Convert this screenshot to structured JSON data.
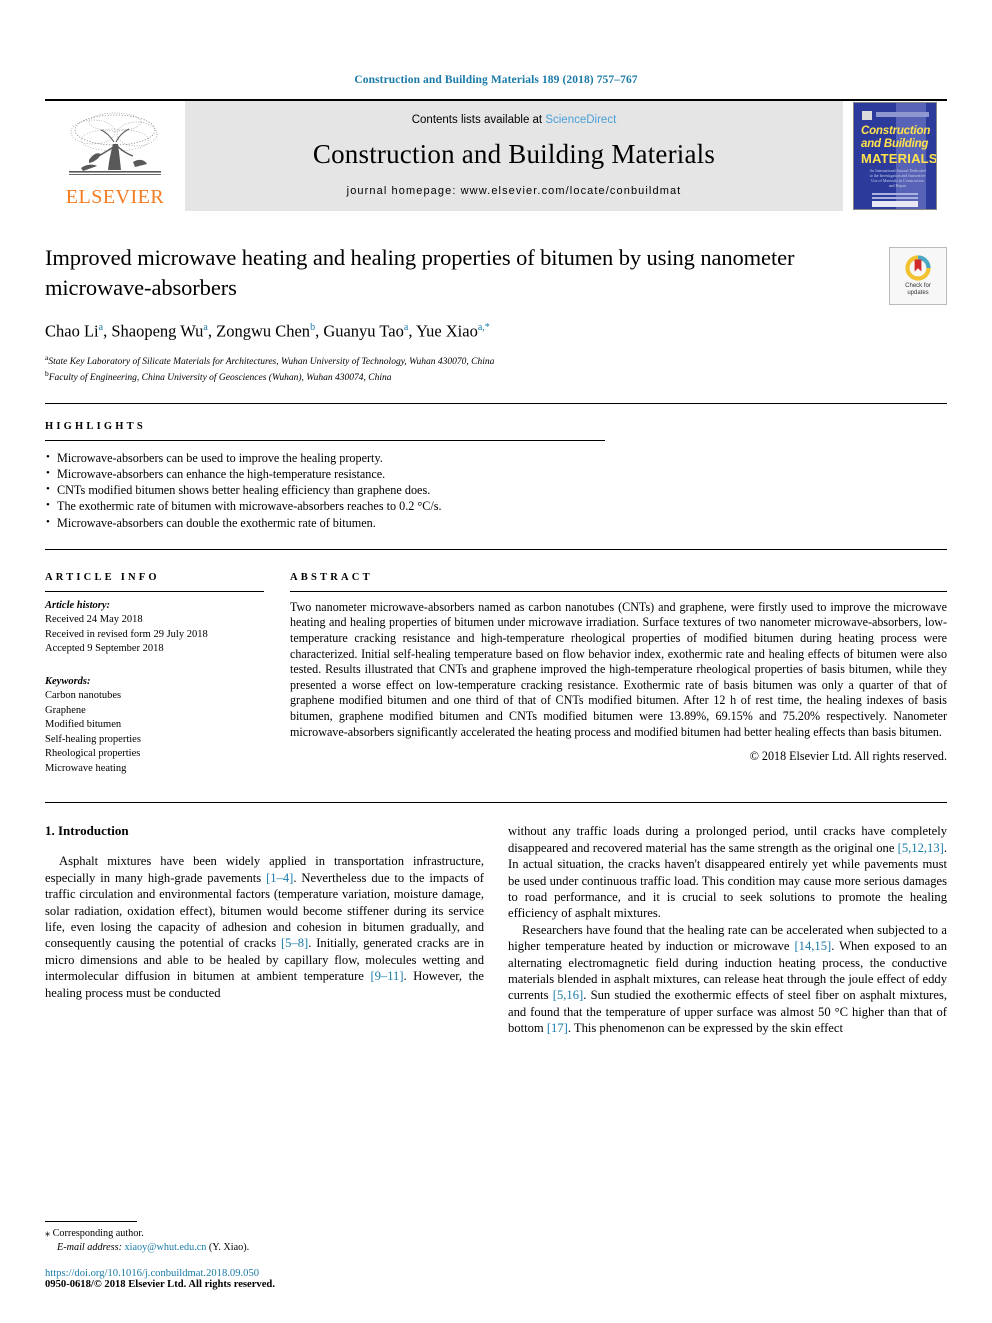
{
  "running_head": "Construction and Building Materials 189 (2018) 757–767",
  "masthead": {
    "contents_prefix": "Contents lists available at ",
    "sciencedirect": "ScienceDirect",
    "journal_title": "Construction and Building Materials",
    "homepage": "journal homepage: www.elsevier.com/locate/conbuildmat",
    "publisher": "ELSEVIER",
    "cover": {
      "line1": "Construction",
      "line2": "and Building",
      "line3": "MATERIALS",
      "description": "An International Journal Dedicated to the Investigation and Innovative Use of Materials in Construction and Repair"
    }
  },
  "article": {
    "title": "Improved microwave heating and healing properties of bitumen by using nanometer microwave-absorbers",
    "authors_html": "Chao Li<sup>a</sup>, Shaopeng Wu<sup>a</sup>, Zongwu Chen<sup>b</sup>, Guanyu Tao<sup>a</sup>, Yue Xiao<sup>a,*</sup>",
    "affiliations": [
      "State Key Laboratory of Silicate Materials for Architectures, Wuhan University of Technology, Wuhan 430070, China",
      "Faculty of Engineering, China University of Geosciences (Wuhan), Wuhan 430074, China"
    ],
    "affiliation_marks": [
      "a",
      "b"
    ],
    "crossmark_label_line1": "Check for",
    "crossmark_label_line2": "updates"
  },
  "highlights": {
    "heading": "HIGHLIGHTS",
    "items": [
      "Microwave-absorbers can be used to improve the healing property.",
      "Microwave-absorbers can enhance the high-temperature resistance.",
      "CNTs modified bitumen shows better healing efficiency than graphene does.",
      "The exothermic rate of bitumen with microwave-absorbers reaches to 0.2 °C/s.",
      "Microwave-absorbers can double the exothermic rate of bitumen."
    ]
  },
  "article_info": {
    "heading": "ARTICLE INFO",
    "history_label": "Article history:",
    "history": [
      "Received 24 May 2018",
      "Received in revised form 29 July 2018",
      "Accepted 9 September 2018"
    ],
    "keywords_label": "Keywords:",
    "keywords": [
      "Carbon nanotubes",
      "Graphene",
      "Modified bitumen",
      "Self-healing properties",
      "Rheological properties",
      "Microwave heating"
    ]
  },
  "abstract": {
    "heading": "ABSTRACT",
    "text": "Two nanometer microwave-absorbers named as carbon nanotubes (CNTs) and graphene, were firstly used to improve the microwave heating and healing properties of bitumen under microwave irradiation. Surface textures of two nanometer microwave-absorbers, low-temperature cracking resistance and high-temperature rheological properties of modified bitumen during heating process were characterized. Initial self-healing temperature based on flow behavior index, exothermic rate and healing effects of bitumen were also tested. Results illustrated that CNTs and graphene improved the high-temperature rheological properties of basis bitumen, while they presented a worse effect on low-temperature cracking resistance. Exothermic rate of basis bitumen was only a quarter of that of graphene modified bitumen and one third of that of CNTs modified bitumen. After 12 h of rest time, the healing indexes of basis bitumen, graphene modified bitumen and CNTs modified bitumen were 13.89%, 69.15% and 75.20% respectively. Nanometer microwave-absorbers significantly accelerated the heating process and modified bitumen had better healing effects than basis bitumen.",
    "copyright": "© 2018 Elsevier Ltd. All rights reserved."
  },
  "body": {
    "section_title": "1. Introduction",
    "left_paragraph_html": "Asphalt mixtures have been widely applied in transportation infrastructure, especially in many high-grade pavements <span class=\"ref\">[1–4]</span>. Nevertheless due to the impacts of traffic circulation and environmental factors (temperature variation, moisture damage, solar radiation, oxidation effect), bitumen would become stiffener during its service life, even losing the capacity of adhesion and cohesion in bitumen gradually, and consequently causing the potential of cracks <span class=\"ref\">[5–8]</span>. Initially, generated cracks are in micro dimensions and able to be healed by capillary flow, molecules wetting and intermolecular diffusion in bitumen at ambient temperature <span class=\"ref\">[9–11]</span>. However, the healing process must be conducted",
    "right_paragraph1_html": "without any traffic loads during a prolonged period, until cracks have completely disappeared and recovered material has the same strength as the original one <span class=\"ref\">[5,12,13]</span>. In actual situation, the cracks haven't disappeared entirely yet while pavements must be used under continuous traffic load. This condition may cause more serious damages to road performance, and it is crucial to seek solutions to promote the healing efficiency of asphalt mixtures.",
    "right_paragraph2_html": "Researchers have found that the healing rate can be accelerated when subjected to a higher temperature heated by induction or microwave <span class=\"ref\">[14,15]</span>. When exposed to an alternating electromagnetic field during induction heating process, the conductive materials blended in asphalt mixtures, can release heat through the joule effect of eddy currents <span class=\"ref\">[5,16]</span>. Sun studied the exothermic effects of steel fiber on asphalt mixtures, and found that the temperature of upper surface was almost 50 °C higher than that of bottom <span class=\"ref\">[17]</span>. This phenomenon can be expressed by the skin effect"
  },
  "footnotes": {
    "corresponding_mark": "⁎",
    "corresponding_author": "Corresponding author.",
    "email_label": "E-mail address:",
    "email": "xiaoy@whut.edu.cn",
    "email_suffix": "(Y. Xiao).",
    "doi": "https://doi.org/10.1016/j.conbuildmat.2018.09.050",
    "issn_line": "0950-0618/© 2018 Elsevier Ltd. All rights reserved."
  },
  "colors": {
    "link_blue": "#1a7aa8",
    "sciencedirect_blue": "#4a9fd8",
    "elsevier_orange": "#F47B20",
    "cover_blue": "#2c3a9c",
    "cover_yellow": "#ffe24d",
    "masthead_gray": "#e5e5e5"
  }
}
